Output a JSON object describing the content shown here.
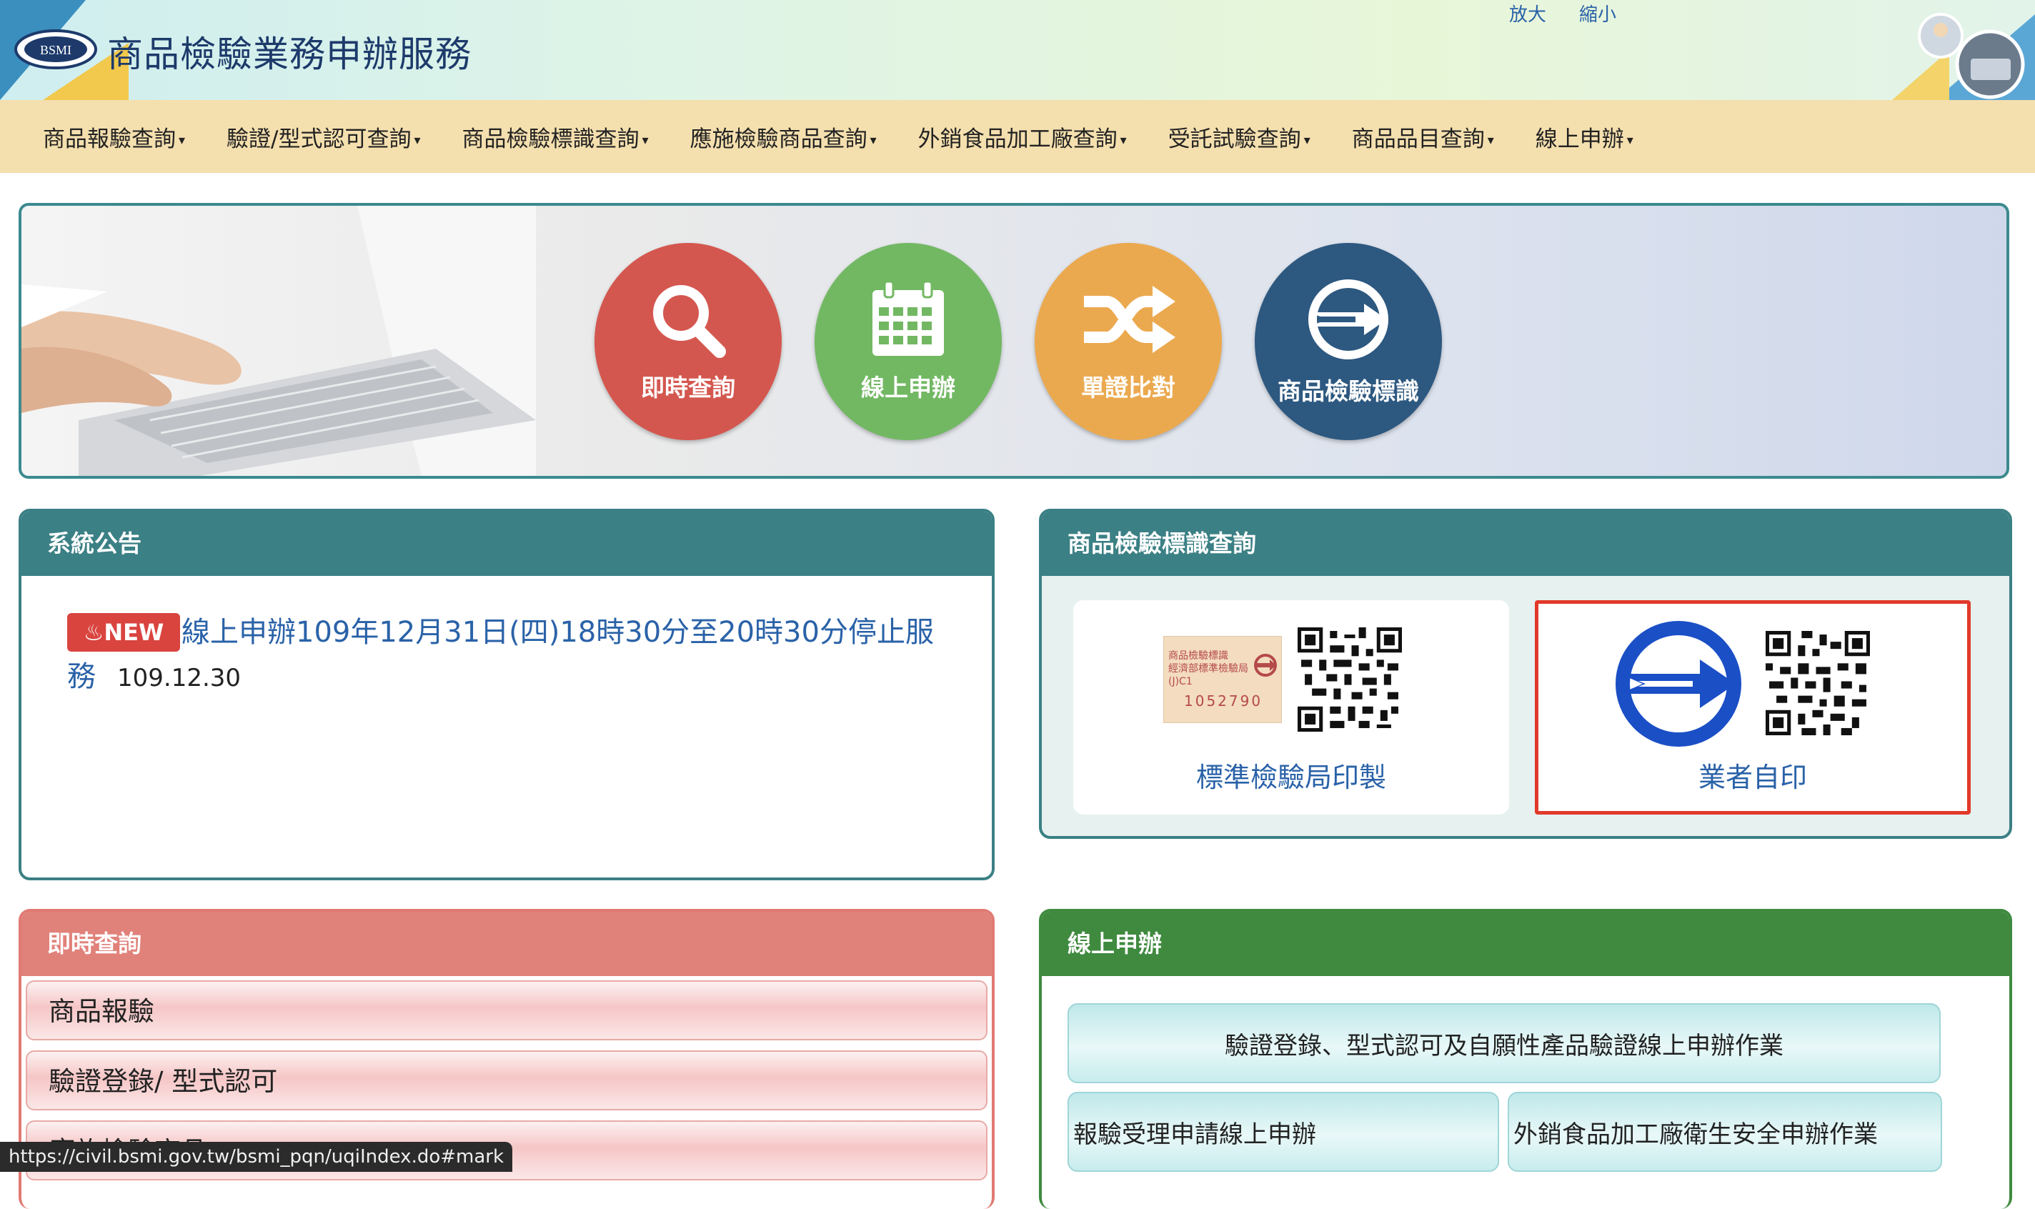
{
  "header": {
    "title": "商品檢驗業務申辦服務",
    "logo_text": "BSMI",
    "font_enlarge": "放大",
    "font_shrink": "縮小"
  },
  "nav": {
    "items": [
      "商品報驗查詢",
      "驗證/型式認可查詢",
      "商品檢驗標識查詢",
      "應施檢驗商品查詢",
      "外銷食品加工廠查詢",
      "受託試驗查詢",
      "商品品目查詢",
      "線上申辦"
    ]
  },
  "banner": {
    "buttons": [
      {
        "label": "即時查詢",
        "icon": "search-icon",
        "color": "#d4574f"
      },
      {
        "label": "線上申辦",
        "icon": "calendar-icon",
        "color": "#72b863"
      },
      {
        "label": "單證比對",
        "icon": "shuffle-icon",
        "color": "#eba94f"
      },
      {
        "label": "商品檢驗標識",
        "icon": "bsmi-mark-icon",
        "color": "#2d5880"
      }
    ]
  },
  "announcements": {
    "title": "系統公告",
    "badge": "NEW",
    "items": [
      {
        "text": "線上申辦109年12月31日(四)18時30分至20時30分停止服務",
        "date": "109.12.30"
      }
    ]
  },
  "mark_query": {
    "title": "商品檢驗標識查詢",
    "cards": [
      {
        "caption": "標準檢驗局印製",
        "label_lines": [
          "商品檢驗標識",
          "經濟部標準檢驗局",
          "(J)C1",
          "1052790"
        ]
      },
      {
        "caption": "業者自印"
      }
    ]
  },
  "instant_query": {
    "title": "即時查詢",
    "items": [
      "商品報驗",
      "驗證登錄/  型式認可",
      "應施檢驗商品"
    ]
  },
  "online_apply": {
    "title": "線上申辦",
    "items": [
      "驗證登錄、型式認可及自願性產品驗證線上申辦作業",
      "報驗受理申請線上申辦",
      "外銷食品加工廠衛生安全申辦作業"
    ]
  },
  "status_bar": {
    "url": "https://civil.bsmi.gov.tw/bsmi_pqn/uqiIndex.do#mark"
  }
}
